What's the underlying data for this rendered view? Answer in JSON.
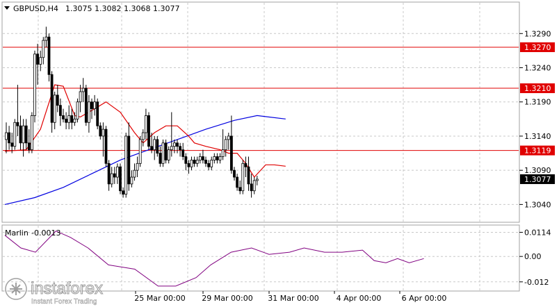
{
  "header": {
    "symbol": "GBPUSD,H4",
    "ohlc": "1.3075 1.3082 1.3068 1.3077"
  },
  "indicator": {
    "name": "Marlin",
    "value": "-0.0013",
    "ticks": [
      "0.0114",
      "0.00",
      "-0.012"
    ],
    "color": "#800080"
  },
  "levels": [
    {
      "value": 1.327,
      "label": "1.3270"
    },
    {
      "value": 1.321,
      "label": "1.3210"
    },
    {
      "value": 1.3119,
      "label": "1.3119"
    }
  ],
  "current_price": {
    "value": 1.3077,
    "label": "1.3077"
  },
  "watermark": {
    "brand": "instaforex",
    "tagline": "Instant Forex Trading"
  },
  "chart_data": {
    "type": "candlestick",
    "ylim": [
      1.3015,
      1.3335
    ],
    "y_ticks": [
      "1.3290",
      "1.3240",
      "1.3190",
      "1.3140",
      "1.3090",
      "1.3040"
    ],
    "x_ticks": [
      "25 Mar 00:00",
      "29 Mar 00:00",
      "31 Mar 00:00",
      "4 Apr 00:00",
      "6 Apr 00:00"
    ],
    "colors": {
      "candle": "#000000",
      "ma_fast": "#e00000",
      "ma_slow": "#0000e0",
      "level": "#e00000"
    },
    "candles": [
      [
        1.3135,
        1.316,
        1.3115,
        1.3145
      ],
      [
        1.3145,
        1.3155,
        1.312,
        1.313
      ],
      [
        1.313,
        1.3145,
        1.3115,
        1.3125
      ],
      [
        1.3125,
        1.3165,
        1.312,
        1.316
      ],
      [
        1.316,
        1.3215,
        1.314,
        1.3155
      ],
      [
        1.3155,
        1.317,
        1.312,
        1.313
      ],
      [
        1.313,
        1.3165,
        1.311,
        1.3155
      ],
      [
        1.3155,
        1.3165,
        1.312,
        1.313
      ],
      [
        1.313,
        1.315,
        1.3115,
        1.312
      ],
      [
        1.312,
        1.3175,
        1.3115,
        1.317
      ],
      [
        1.317,
        1.3265,
        1.316,
        1.326
      ],
      [
        1.326,
        1.3275,
        1.3215,
        1.3245
      ],
      [
        1.3245,
        1.3265,
        1.3235,
        1.3255
      ],
      [
        1.3255,
        1.3285,
        1.3245,
        1.328
      ],
      [
        1.328,
        1.33,
        1.327,
        1.3285
      ],
      [
        1.3285,
        1.329,
        1.322,
        1.323
      ],
      [
        1.323,
        1.3235,
        1.3145,
        1.316
      ],
      [
        1.316,
        1.3205,
        1.315,
        1.32
      ],
      [
        1.32,
        1.3215,
        1.3175,
        1.3185
      ],
      [
        1.3185,
        1.3195,
        1.3155,
        1.317
      ],
      [
        1.317,
        1.318,
        1.316,
        1.3165
      ],
      [
        1.3165,
        1.3175,
        1.315,
        1.316
      ],
      [
        1.316,
        1.3185,
        1.315,
        1.317
      ],
      [
        1.317,
        1.318,
        1.315,
        1.316
      ],
      [
        1.316,
        1.3175,
        1.3155,
        1.3165
      ],
      [
        1.3165,
        1.3195,
        1.316,
        1.319
      ],
      [
        1.319,
        1.3215,
        1.3175,
        1.3205
      ],
      [
        1.3205,
        1.3225,
        1.319,
        1.321
      ],
      [
        1.321,
        1.3215,
        1.3155,
        1.316
      ],
      [
        1.316,
        1.32,
        1.3145,
        1.319
      ],
      [
        1.319,
        1.3195,
        1.3165,
        1.318
      ],
      [
        1.318,
        1.32,
        1.317,
        1.319
      ],
      [
        1.319,
        1.3195,
        1.315,
        1.3155
      ],
      [
        1.3155,
        1.316,
        1.3135,
        1.314
      ],
      [
        1.314,
        1.316,
        1.311,
        1.315
      ],
      [
        1.315,
        1.3155,
        1.3095,
        1.31
      ],
      [
        1.31,
        1.3105,
        1.306,
        1.307
      ],
      [
        1.307,
        1.3095,
        1.3065,
        1.3085
      ],
      [
        1.3085,
        1.3095,
        1.307,
        1.308
      ],
      [
        1.308,
        1.31,
        1.307,
        1.3095
      ],
      [
        1.3095,
        1.31,
        1.3055,
        1.306
      ],
      [
        1.306,
        1.3065,
        1.305,
        1.3055
      ],
      [
        1.3055,
        1.3145,
        1.305,
        1.314
      ],
      [
        1.314,
        1.316,
        1.306,
        1.307
      ],
      [
        1.307,
        1.309,
        1.3065,
        1.308
      ],
      [
        1.308,
        1.31,
        1.3075,
        1.309
      ],
      [
        1.309,
        1.311,
        1.308,
        1.31
      ],
      [
        1.31,
        1.314,
        1.3095,
        1.3135
      ],
      [
        1.3135,
        1.315,
        1.3125,
        1.3145
      ],
      [
        1.3145,
        1.318,
        1.3135,
        1.317
      ],
      [
        1.317,
        1.3175,
        1.312,
        1.3125
      ],
      [
        1.3125,
        1.3145,
        1.3115,
        1.312
      ],
      [
        1.312,
        1.314,
        1.3105,
        1.3135
      ],
      [
        1.3135,
        1.314,
        1.311,
        1.3115
      ],
      [
        1.3115,
        1.3125,
        1.3095,
        1.31
      ],
      [
        1.31,
        1.3135,
        1.3095,
        1.313
      ],
      [
        1.313,
        1.3135,
        1.31,
        1.3105
      ],
      [
        1.3105,
        1.3125,
        1.31,
        1.312
      ],
      [
        1.312,
        1.3175,
        1.311,
        1.3125
      ],
      [
        1.3125,
        1.3135,
        1.3115,
        1.313
      ],
      [
        1.313,
        1.3135,
        1.3115,
        1.3125
      ],
      [
        1.3125,
        1.313,
        1.311,
        1.312
      ],
      [
        1.312,
        1.313,
        1.3105,
        1.311
      ],
      [
        1.311,
        1.3115,
        1.309,
        1.31
      ],
      [
        1.31,
        1.3105,
        1.3085,
        1.3095
      ],
      [
        1.3095,
        1.311,
        1.309,
        1.3105
      ],
      [
        1.3105,
        1.311,
        1.3095,
        1.31
      ],
      [
        1.31,
        1.311,
        1.3095,
        1.3105
      ],
      [
        1.3105,
        1.3115,
        1.31,
        1.311
      ],
      [
        1.311,
        1.312,
        1.31,
        1.3105
      ],
      [
        1.3105,
        1.311,
        1.3095,
        1.31
      ],
      [
        1.31,
        1.3105,
        1.309,
        1.3095
      ],
      [
        1.3095,
        1.311,
        1.309,
        1.3105
      ],
      [
        1.3105,
        1.3115,
        1.31,
        1.311
      ],
      [
        1.311,
        1.3115,
        1.31,
        1.3105
      ],
      [
        1.3105,
        1.3115,
        1.31,
        1.311
      ],
      [
        1.311,
        1.315,
        1.3105,
        1.312
      ],
      [
        1.312,
        1.314,
        1.311,
        1.3135
      ],
      [
        1.3135,
        1.3145,
        1.312,
        1.314
      ],
      [
        1.314,
        1.317,
        1.3085,
        1.309
      ],
      [
        1.309,
        1.3095,
        1.3075,
        1.308
      ],
      [
        1.308,
        1.3085,
        1.306,
        1.3065
      ],
      [
        1.3065,
        1.3075,
        1.3055,
        1.306
      ],
      [
        1.306,
        1.3105,
        1.3055,
        1.31
      ],
      [
        1.31,
        1.311,
        1.308,
        1.3095
      ],
      [
        1.3095,
        1.311,
        1.306,
        1.307
      ],
      [
        1.307,
        1.3085,
        1.305,
        1.306
      ],
      [
        1.306,
        1.308,
        1.3055,
        1.3075
      ],
      [
        1.3075,
        1.3082,
        1.3068,
        1.3077
      ]
    ],
    "ma_fast": [
      [
        -0.5,
        1.3118
      ],
      [
        7,
        1.312
      ],
      [
        12,
        1.315
      ],
      [
        17,
        1.3215
      ],
      [
        20,
        1.3213
      ],
      [
        24,
        1.317
      ],
      [
        26,
        1.3168
      ],
      [
        31,
        1.318
      ],
      [
        35,
        1.319
      ],
      [
        40,
        1.3175
      ],
      [
        45,
        1.3145
      ],
      [
        48,
        1.313
      ],
      [
        52,
        1.3145
      ],
      [
        56,
        1.3155
      ],
      [
        60,
        1.3155
      ],
      [
        64,
        1.314
      ],
      [
        66,
        1.313
      ],
      [
        70,
        1.3125
      ],
      [
        75,
        1.312
      ],
      [
        78,
        1.3115
      ],
      [
        81,
        1.3115
      ],
      [
        84,
        1.31
      ],
      [
        87,
        1.308
      ],
      [
        91,
        1.3098
      ],
      [
        94,
        1.3098
      ],
      [
        98,
        1.3096
      ]
    ],
    "ma_slow": [
      [
        -0.5,
        1.304
      ],
      [
        10,
        1.305
      ],
      [
        20,
        1.3065
      ],
      [
        30,
        1.3085
      ],
      [
        40,
        1.3105
      ],
      [
        50,
        1.312
      ],
      [
        60,
        1.3135
      ],
      [
        70,
        1.315
      ],
      [
        80,
        1.3163
      ],
      [
        88,
        1.317
      ],
      [
        98,
        1.3165
      ]
    ],
    "marlin": [
      [
        -0.5,
        0.01
      ],
      [
        5,
        0.004
      ],
      [
        10,
        0.002
      ],
      [
        17,
        0.012
      ],
      [
        22,
        0.009
      ],
      [
        28,
        0.004
      ],
      [
        35,
        -0.004
      ],
      [
        44,
        -0.006
      ],
      [
        52,
        -0.014
      ],
      [
        58,
        -0.014
      ],
      [
        65,
        -0.01
      ],
      [
        70,
        -0.004
      ],
      [
        77,
        0.002
      ],
      [
        84,
        0.004
      ],
      [
        90,
        0.001
      ],
      [
        97,
        0.002
      ],
      [
        102,
        0.004
      ],
      [
        109,
        0.002
      ],
      [
        115,
        0.002
      ],
      [
        122,
        0.003
      ],
      [
        126,
        -0.002
      ],
      [
        130,
        -0.003
      ],
      [
        134,
        -0.001
      ],
      [
        138,
        -0.003
      ],
      [
        143,
        -0.001
      ]
    ],
    "marlin_ylim": [
      -0.016,
      0.0145
    ]
  }
}
